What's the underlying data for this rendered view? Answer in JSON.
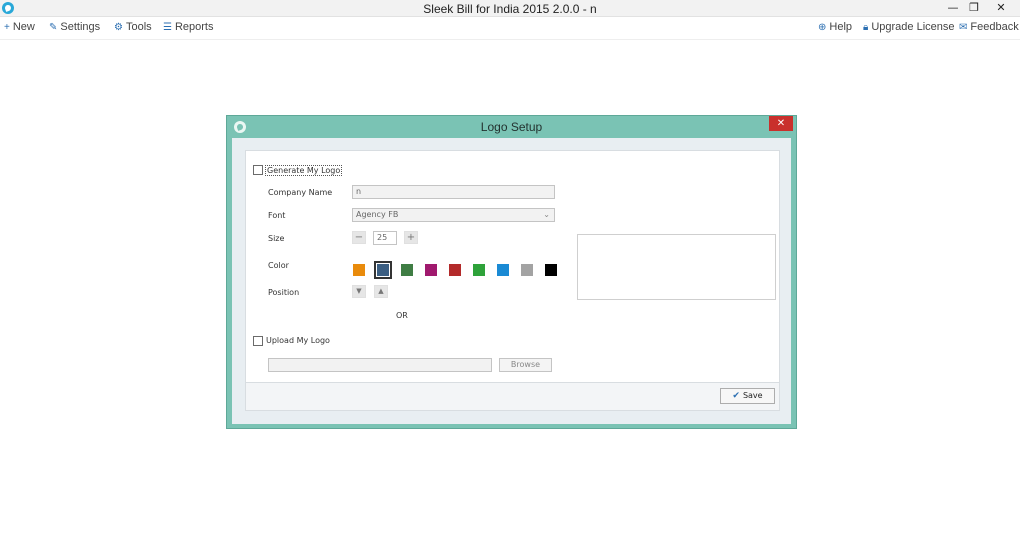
{
  "app": {
    "title": "Sleek Bill for India 2015 2.0.0 - n"
  },
  "window_controls": {
    "minimize": "—",
    "restore": "❐",
    "close": "✕"
  },
  "menu": {
    "new": "New",
    "settings": "Settings",
    "tools": "Tools",
    "reports": "Reports",
    "help": "Help",
    "upgrade": "Upgrade License",
    "feedback": "Feedback"
  },
  "dialog": {
    "title": "Logo Setup",
    "close_glyph": "✕",
    "generate_label": "Generate My Logo",
    "company_name_label": "Company Name",
    "company_name_value": "n",
    "font_label": "Font",
    "font_value": "Agency FB",
    "size_label": "Size",
    "size_value": "25",
    "color_label": "Color",
    "colors": [
      "#e98b0c",
      "#3b5e82",
      "#3f7d44",
      "#a0196e",
      "#b32a2a",
      "#2ea23a",
      "#1a8ad4",
      "#a3a3a3",
      "#000000"
    ],
    "selected_color_index": 1,
    "position_label": "Position",
    "or_label": "OR",
    "upload_label": "Upload My Logo",
    "upload_path_value": "",
    "browse_label": "Browse",
    "save_label": "Save"
  }
}
